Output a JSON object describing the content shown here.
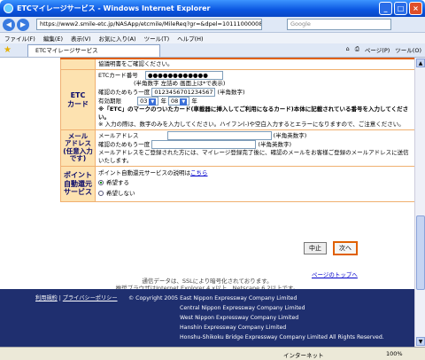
{
  "window": {
    "title": "ETCマイレージサービス - Windows Internet Explorer"
  },
  "address": {
    "url": "https://www2.smile-etc.jp/NASApp/etcmile/MileReq?gr=&dpel=10111000008.mdx",
    "search_placeholder": "Google"
  },
  "menu": [
    "ファイル(F)",
    "編集(E)",
    "表示(V)",
    "お気に入り(A)",
    "ツール(T)",
    "ヘルプ(H)"
  ],
  "tab": {
    "label": "ETCマイレージサービス"
  },
  "toolbar": {
    "page": "ページ(P)",
    "tools": "ツール(O)"
  },
  "form": {
    "top_text": "協議明書をご確認ください。",
    "etc": {
      "label": "ETC\nカード",
      "card_number_label": "ETCカード番号",
      "card_number_value": "●●●●●●●●●●●●",
      "card_number_note": "(半角数字 左詰め 画面上は*で表示)",
      "confirm_label": "確認のためもう一度",
      "confirm_value": "0123456701234567",
      "confirm_note": "(半角数字)",
      "expiry_label": "有効期限",
      "expiry_year": "03",
      "year_unit": "年",
      "expiry_month": "08",
      "month_unit": "年",
      "note1": "※「ETC」のマークのついたカード(車載器に挿入してご利用になるカード)本体に記載されている番号を入力してください。",
      "note2": "※ 入力の際は、数字のみを入力してください。ハイフン(-)や空白入力するとエラーになりますので、ご注意ください。"
    },
    "mail": {
      "label": "メール\nアドレス\n(任意入力です)",
      "address_label": "メールアドレス",
      "address_note": "(半角英数字)",
      "confirm_label": "確認のためもう一度",
      "confirm_note": "(半角英数字)",
      "note": "メールアドレスをご登録された方には、マイレージ登録完了後に、確認のメールをお客様ご登録のメールアドレスに送信いたします。"
    },
    "point": {
      "label": "ポイント\n自動還元\nサービス",
      "desc": "ポイント自動還元サービスの説明は",
      "desc_link": "こちら",
      "option_yes": "希望する",
      "option_no": "希望しない"
    }
  },
  "buttons": {
    "stop": "中止",
    "next": "次へ"
  },
  "page_top": "ページのトップへ",
  "notes": {
    "ssl": "通信データは、SSLにより暗号化されております。",
    "browser": "推奨ブラウザはInternet Explorer 4.x以上、Netscape 6.2以上です。"
  },
  "footer": {
    "link1": "利用規約",
    "link2": "プライバシーポリシー",
    "copyright": "© Copyright 2005 East Nippon Expressway Company Limited",
    "c2": "Central Nippon Expressway Company Limited",
    "c3": "West Nippon Expressway Company Limited",
    "c4": "Hanshin Expressway Company Limited",
    "c5": "Honshu-Shikoku Bridge Expressway Company Limited All Rights Reserved."
  },
  "status": {
    "zone": "インターネット",
    "zoom": "100%"
  }
}
